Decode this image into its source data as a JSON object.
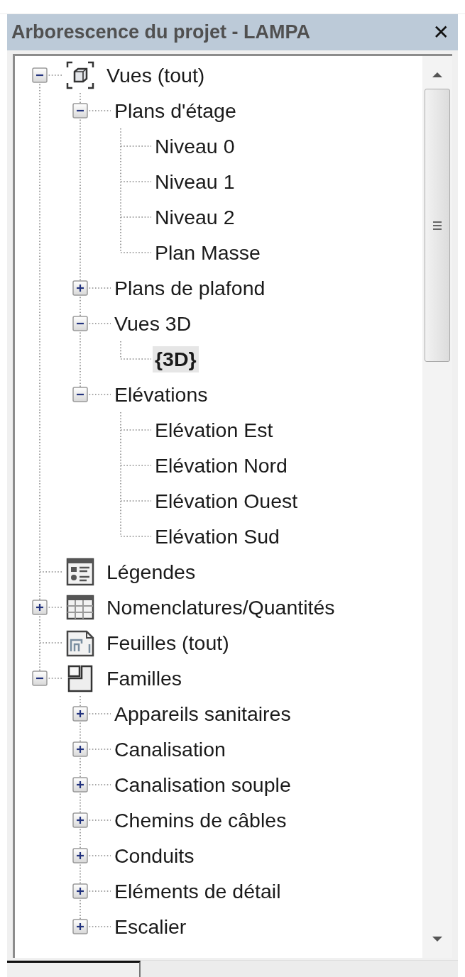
{
  "panel": {
    "title": "Arborescence du projet - LAMPA",
    "close": "✕"
  },
  "tree": [
    {
      "label": "Vues (tout)",
      "kind": "views",
      "expanded": true,
      "selected": false,
      "children": [
        {
          "label": "Plans d'étage",
          "expanded": true,
          "selected": false,
          "children": [
            {
              "label": "Niveau 0",
              "selected": false
            },
            {
              "label": "Niveau 1",
              "selected": false
            },
            {
              "label": "Niveau 2",
              "selected": false
            },
            {
              "label": "Plan Masse",
              "selected": false
            }
          ]
        },
        {
          "label": "Plans de plafond",
          "expanded": false,
          "selected": false
        },
        {
          "label": "Vues 3D",
          "expanded": true,
          "selected": false,
          "children": [
            {
              "label": "{3D}",
              "selected": true
            }
          ]
        },
        {
          "label": "Elévations",
          "expanded": true,
          "selected": false,
          "children": [
            {
              "label": "Elévation Est",
              "selected": false
            },
            {
              "label": "Elévation Nord",
              "selected": false
            },
            {
              "label": "Elévation Ouest",
              "selected": false
            },
            {
              "label": "Elévation Sud",
              "selected": false
            }
          ]
        }
      ]
    },
    {
      "label": "Légendes",
      "kind": "legends",
      "selected": false
    },
    {
      "label": "Nomenclatures/Quantités",
      "kind": "schedules",
      "expanded": false,
      "selected": false
    },
    {
      "label": "Feuilles (tout)",
      "kind": "sheets",
      "selected": false
    },
    {
      "label": "Familles",
      "kind": "families",
      "expanded": true,
      "selected": false,
      "children": [
        {
          "label": "Appareils sanitaires",
          "expanded": false,
          "selected": false
        },
        {
          "label": "Canalisation",
          "expanded": false,
          "selected": false
        },
        {
          "label": "Canalisation souple",
          "expanded": false,
          "selected": false
        },
        {
          "label": "Chemins de câbles",
          "expanded": false,
          "selected": false
        },
        {
          "label": "Conduits",
          "expanded": false,
          "selected": false
        },
        {
          "label": "Eléments de détail",
          "expanded": false,
          "selected": false
        },
        {
          "label": "Escalier",
          "expanded": false,
          "selected": false
        }
      ]
    }
  ]
}
